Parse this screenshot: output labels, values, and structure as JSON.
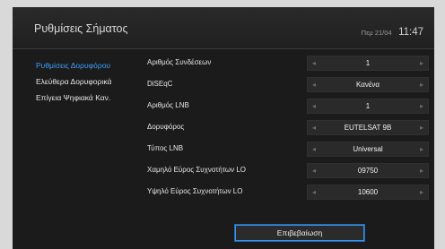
{
  "header": {
    "title": "Ρυθμίσεις Σήματος",
    "date": "Πεμ 21/04",
    "time": "11:47"
  },
  "sidebar": {
    "items": [
      {
        "label": "Ρυθμίσεις Δορυφόρου",
        "active": true
      },
      {
        "label": "Ελεύθερα Δορυφορικά",
        "active": false
      },
      {
        "label": "Επίγεια Ψηφιακά Καν.",
        "active": false
      }
    ]
  },
  "settings": {
    "rows": [
      {
        "label": "Αριθμός Συνδέσεων",
        "value": "1"
      },
      {
        "label": "DiSEqC",
        "value": "Κανένα"
      },
      {
        "label": "Αριθμός LNB",
        "value": "1"
      },
      {
        "label": "Δορυφόρος",
        "value": "EUTELSAT 9B"
      },
      {
        "label": "Τύπος LNB",
        "value": "Universal"
      },
      {
        "label": "Χαμηλό Εύρος Συχνοτήτων LO",
        "value": "09750"
      },
      {
        "label": "Υψηλό Εύρος Συχνοτήτων LO",
        "value": "10600"
      }
    ]
  },
  "confirm_button": {
    "label": "Επιβεβαίωση"
  },
  "icons": {
    "left_arrow": "chevron-left-icon",
    "right_arrow": "chevron-right-icon"
  },
  "colors": {
    "accent": "#3aa0ff",
    "background": "#1b1b1b"
  }
}
